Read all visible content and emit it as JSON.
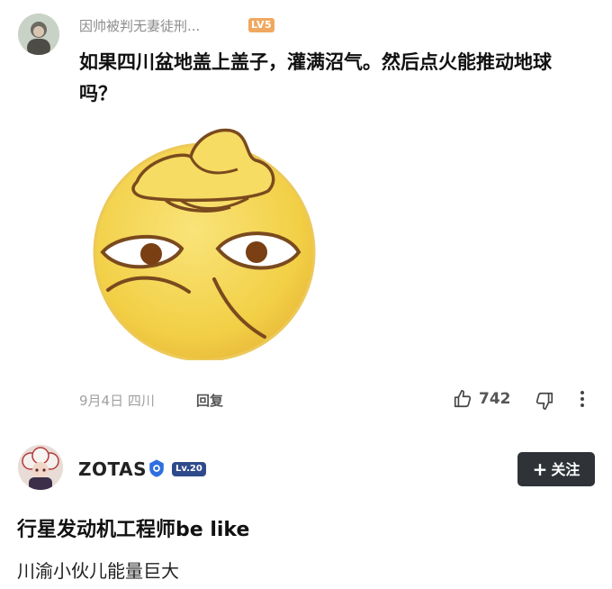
{
  "comment": {
    "username": "因帅被判无妻徒刑...",
    "level_badge": "LV5",
    "text": "如果四川盆地盖上盖子，灌满沼气。然后点火能推动地球吗？",
    "date_location": "9月4日 四川",
    "reply_label": "回复",
    "like_count": "742",
    "avatar_icon": "profile-photo",
    "emoji_icon": "yellow-smirk-face-emoji"
  },
  "post": {
    "author_name": "ZOTAS",
    "level_badge": "Lv.20",
    "follow_label": "关注",
    "title": "行星发动机工程师be like",
    "subtitle": "川渝小伙儿能量巨大",
    "avatar_icon": "anime-character-avatar",
    "verified_icon": "verified-shield"
  },
  "colors": {
    "level_badge_orange": "#f0a860",
    "level_badge_blue": "#2f4a8a",
    "verified_blue": "#2f6fe0",
    "follow_button_bg": "#2f3338",
    "emoji_yellow": "#f4d54b"
  }
}
